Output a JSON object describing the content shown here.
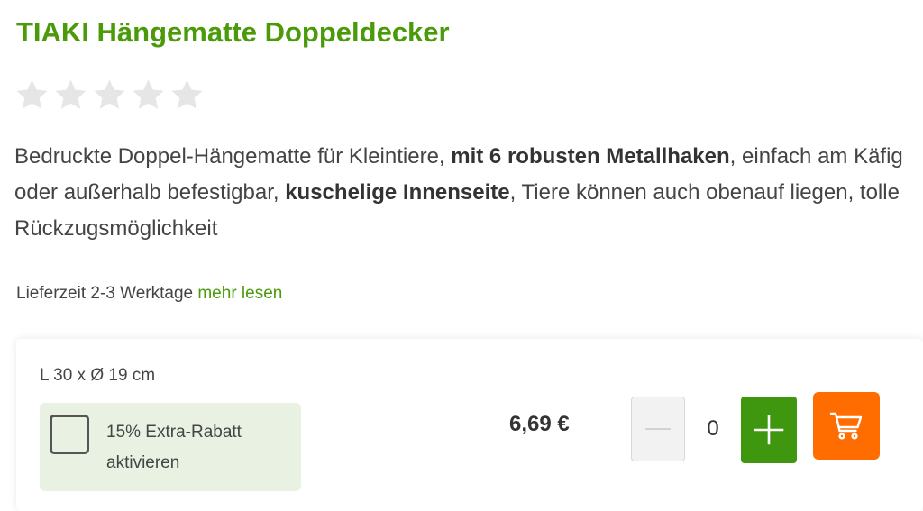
{
  "product": {
    "title": "TIAKI Hängematte Doppeldecker",
    "rating": {
      "value": 0,
      "max": 5
    },
    "description": {
      "part1": "Bedruckte Doppel-Hängematte für Kleintiere, ",
      "bold1": "mit 6 robusten Metallhaken",
      "part2": ", einfach am Käfig oder außerhalb befestigbar, ",
      "bold2": "kuschelige Innenseite",
      "part3": ", Tiere können auch obenauf liegen, tolle Rückzugsmöglichkeit"
    },
    "delivery": {
      "text": "Lieferzeit 2-3 Werktage ",
      "link": "mehr lesen"
    }
  },
  "offer": {
    "variant": "L 30 x Ø 19 cm",
    "discount_label": "15% Extra-Rabatt aktivieren",
    "discount_checked": false,
    "price": "6,69 €",
    "quantity": "0",
    "minus_icon": "minus-icon",
    "plus_icon": "plus-icon",
    "cart_icon": "shopping-cart-icon"
  },
  "colors": {
    "brand_green": "#4a9a0a",
    "plus_button": "#3f960f",
    "cart_button": "#ff6d00",
    "discount_bg": "#e8f1e2",
    "star_empty": "#e6e6e6"
  }
}
